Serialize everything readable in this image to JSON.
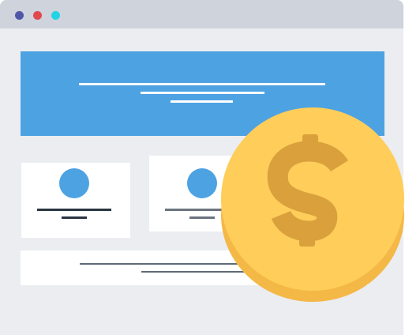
{
  "colors": {
    "window_bg": "#ebedf1",
    "titlebar": "#ced3dc",
    "dot_1": "#5157a8",
    "dot_2": "#e1484e",
    "dot_3": "#22d3e6",
    "hero": "#4da2e2",
    "card": "#ffffff",
    "text_dark": "#2b3644",
    "text_mid": "#6b7380",
    "coin_face": "#fecd5a",
    "coin_edge": "#f4b847",
    "coin_symbol": "#d9a03c"
  },
  "icons": {
    "coin": "dollar-coin-icon",
    "symbol": "$"
  }
}
